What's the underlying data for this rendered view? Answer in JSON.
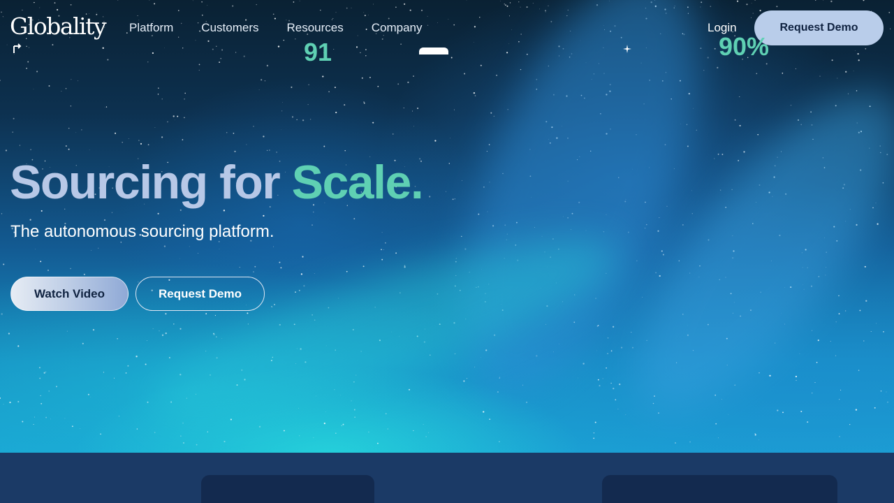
{
  "brand": {
    "logo_text": "Globality"
  },
  "nav": {
    "links": [
      "Platform",
      "Customers",
      "Resources",
      "Company"
    ],
    "login_label": "Login",
    "cta_label": "Request Demo"
  },
  "hero": {
    "headline_main": "Sourcing for ",
    "headline_accent": "Scale.",
    "subtitle": "The autonomous sourcing platform.",
    "primary_button": "Watch Video",
    "secondary_button": "Request Demo"
  },
  "stats": {
    "values": [
      "91",
      "90%"
    ]
  },
  "colors": {
    "accent": "#5fd0b3",
    "headline": "#b7c8e7",
    "nav_cta_bg": "#b9cdea",
    "stats_bg": "#1b3a66",
    "stat_card_bg": "#132a4f"
  },
  "icons": [
    "play-icon",
    "document-icon",
    "sparkle-icon"
  ]
}
